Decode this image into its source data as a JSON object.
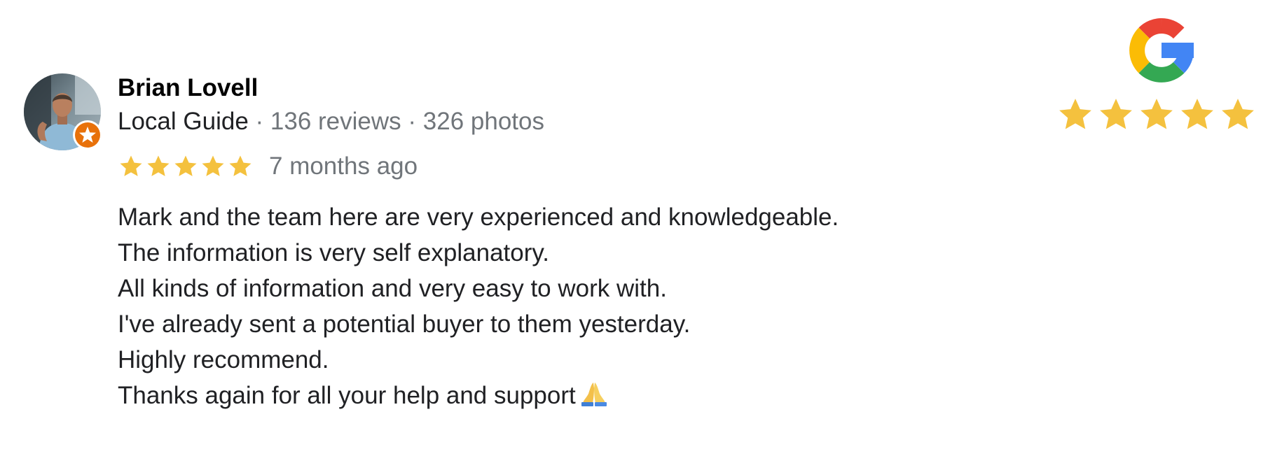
{
  "reviewer": {
    "name": "Brian Lovell",
    "badge": "Local Guide",
    "separator": " · ",
    "reviews": "136 reviews",
    "photos": "326 photos"
  },
  "review": {
    "rating": 5,
    "rating_max": 5,
    "time_ago": "7 months ago",
    "lines": [
      "Mark and the team here are very experienced and knowledgeable.",
      "The information is very self explanatory.",
      "All kinds of information and very easy to work with.",
      "I've already sent a potential buyer to them yesterday.",
      "Highly recommend.",
      "Thanks again for all your help and support"
    ],
    "trailing_icon": "folded-hands-icon"
  },
  "google_badge": {
    "logo": "google-g-icon",
    "stars": 5
  },
  "colors": {
    "star": "#f4c13e",
    "muted_text": "#70757a",
    "local_guide_badge": "#e8710a",
    "google_red": "#ea4335",
    "google_yellow": "#fbbc05",
    "google_green": "#34a853",
    "google_blue": "#4285f4"
  }
}
